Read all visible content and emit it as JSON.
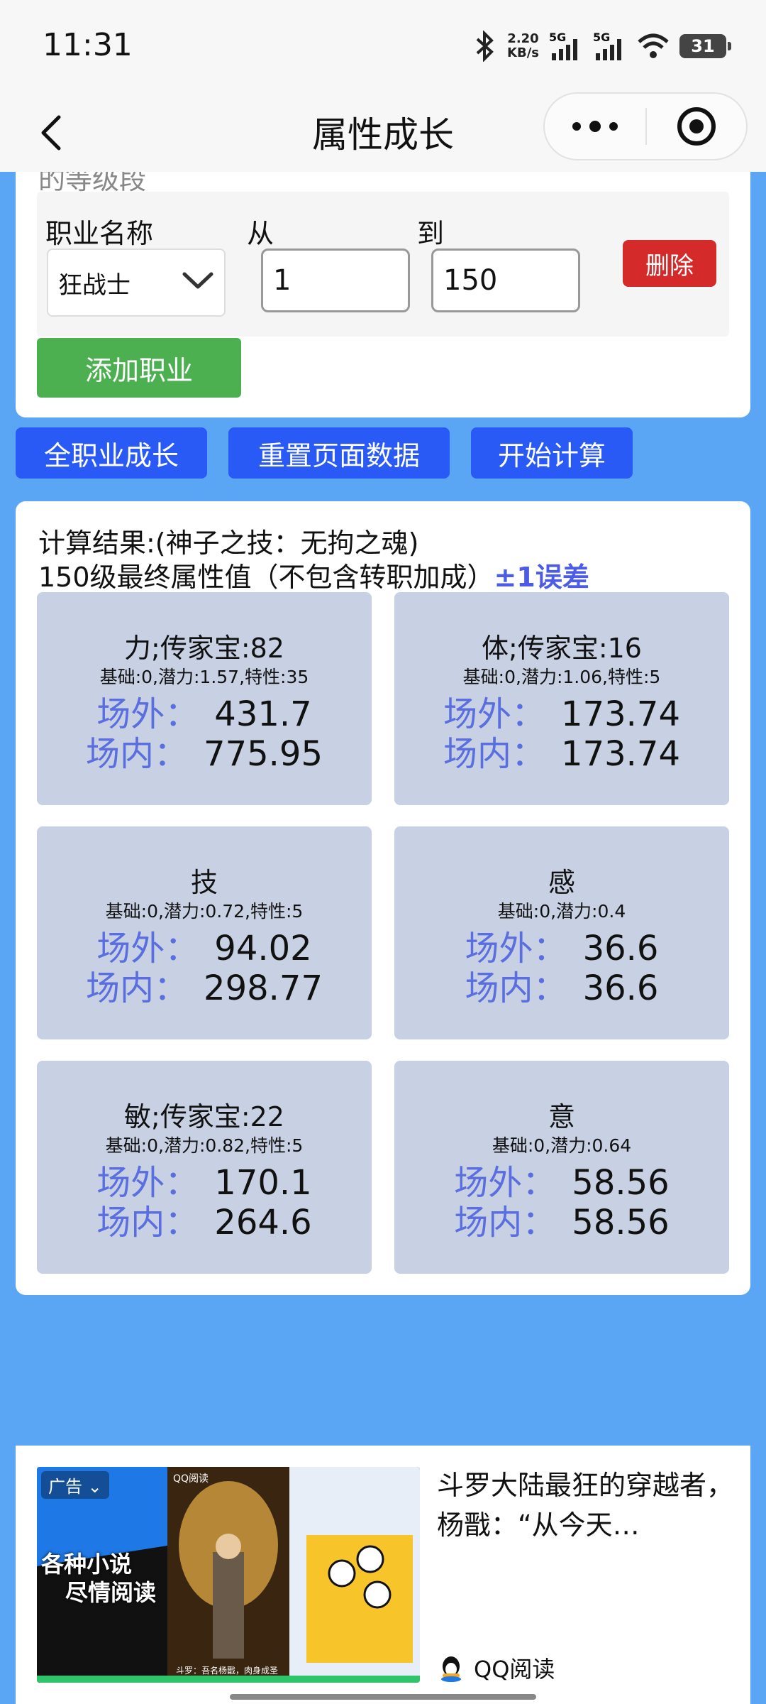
{
  "status_bar": {
    "time": "11:31",
    "net_speed_value": "2.20",
    "net_speed_unit": "KB/s",
    "signal1": "5G",
    "signal2": "5G",
    "battery": "31"
  },
  "nav": {
    "title": "属性成长"
  },
  "job_form": {
    "cut_text": "的等级段",
    "job_label": "职业名称",
    "from_label": "从",
    "to_label": "到",
    "job_value": "狂战士",
    "from_value": "1",
    "to_value": "150",
    "delete_label": "删除",
    "add_label": "添加职业"
  },
  "actions": {
    "all_growth": "全职业成长",
    "reset": "重置页面数据",
    "start": "开始计算"
  },
  "result": {
    "title": "计算结果:(神子之技：无拘之魂)",
    "subtitle": "150级最终属性值（不包含转职加成）",
    "error_note": "±1误差",
    "outside_label": "场外：",
    "inside_label": "场内：",
    "stats": [
      {
        "name": "力;传家宝:82",
        "meta": "基础:0,潜力:1.57,特性:35",
        "outside": "431.7",
        "inside": "775.95"
      },
      {
        "name": "体;传家宝:16",
        "meta": "基础:0,潜力:1.06,特性:5",
        "outside": "173.74",
        "inside": "173.74"
      },
      {
        "name": "技",
        "meta": "基础:0,潜力:0.72,特性:5",
        "outside": "94.02",
        "inside": "298.77"
      },
      {
        "name": "感",
        "meta": "基础:0,潜力:0.4",
        "outside": "36.6",
        "inside": "36.6"
      },
      {
        "name": "敏;传家宝:22",
        "meta": "基础:0,潜力:0.82,特性:5",
        "outside": "170.1",
        "inside": "264.6"
      },
      {
        "name": "意",
        "meta": "基础:0,潜力:0.64",
        "outside": "58.56",
        "inside": "58.56"
      }
    ]
  },
  "ad": {
    "tag": "广告",
    "slogan_line1": "各种小说",
    "slogan_line2": "尽情阅读",
    "app_badge": "QQ阅读",
    "book_caption": "斗罗：吾名杨戬，肉身成圣",
    "headline": "斗罗大陆最狂的穿越者，杨戬：“从今天…",
    "brand": "QQ阅读"
  }
}
